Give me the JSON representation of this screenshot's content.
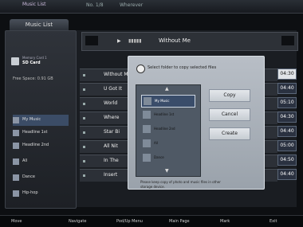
{
  "app_title": "Music List",
  "header_info": "No. 1/8",
  "header_info2": "Wherever",
  "device_label": "Memory Card 1",
  "device_name": "SD Card",
  "free_space": "Free Space: 0.91 GB",
  "sidebar_items": [
    {
      "label": "My Music"
    },
    {
      "label": "Headline 1st"
    },
    {
      "label": "Headline 2nd"
    },
    {
      "label": "All"
    },
    {
      "label": "Dance"
    },
    {
      "label": "Hip-hop"
    }
  ],
  "now_playing_title": "Without Me",
  "play_icon": "▶",
  "list_rows": [
    {
      "title": "Without Me",
      "time": "04:30"
    },
    {
      "title": "U Got It",
      "time": "04:40"
    },
    {
      "title": "World",
      "time": "05:10"
    },
    {
      "title": "Where",
      "time": "04:30"
    },
    {
      "title": "Star Bi",
      "time": "04:40"
    },
    {
      "title": "All Nit",
      "time": "05:00"
    },
    {
      "title": "In The",
      "time": "04:50"
    },
    {
      "title": "Insert",
      "time": "04:40"
    }
  ],
  "dialog": {
    "heading": "Select folder to copy selected files",
    "folders": [
      "My Music",
      "Headline 1st",
      "Headline 2nd",
      "All",
      "Dance"
    ],
    "buttons": [
      "Copy",
      "Cancel",
      "Create"
    ],
    "note": "Please keep copy of photo and music files in other storage device."
  },
  "bottom_hints": [
    "Move",
    "Navigate",
    "Pod/Up Menu",
    "Main Page",
    "Mark",
    "Exit"
  ]
}
